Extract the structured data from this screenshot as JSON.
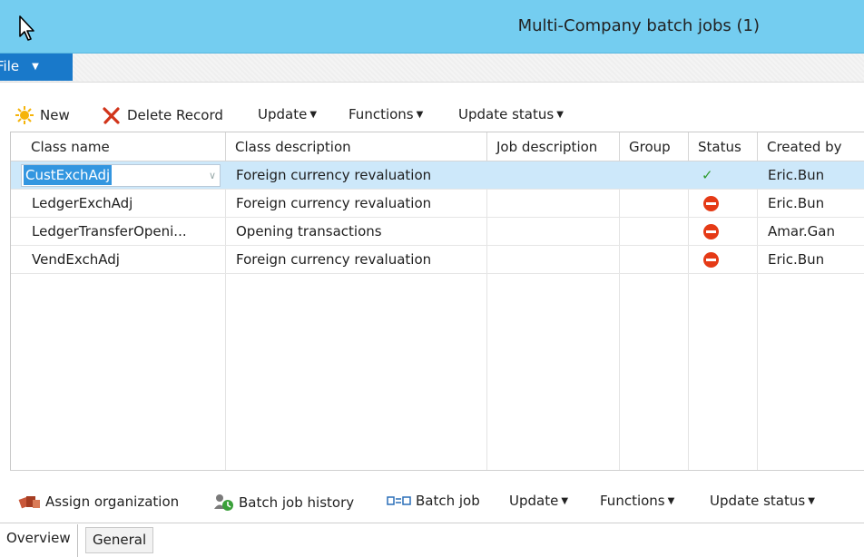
{
  "window": {
    "title": "Multi-Company batch jobs (1)"
  },
  "menu": {
    "file_label": "File"
  },
  "toolbar": {
    "new_label": "New",
    "delete_label": "Delete Record",
    "update_label": "Update",
    "functions_label": "Functions",
    "update_status_label": "Update status"
  },
  "grid": {
    "columns": [
      "Class name",
      "Class description",
      "Job description",
      "Group",
      "Status",
      "Created by"
    ],
    "rows": [
      {
        "class_name": "CustExchAdj",
        "class_description": "Foreign currency revaluation",
        "job_description": "",
        "group": "",
        "status": "success",
        "created_by": "Eric.Bun"
      },
      {
        "class_name": "LedgerExchAdj",
        "class_description": "Foreign currency revaluation",
        "job_description": "",
        "group": "",
        "status": "error",
        "created_by": "Eric.Bun"
      },
      {
        "class_name": "LedgerTransferOpeni...",
        "class_description": "Opening transactions",
        "job_description": "",
        "group": "",
        "status": "error",
        "created_by": "Amar.Gan"
      },
      {
        "class_name": "VendExchAdj",
        "class_description": "Foreign currency revaluation",
        "job_description": "",
        "group": "",
        "status": "error",
        "created_by": "Eric.Bun"
      }
    ]
  },
  "bottom_toolbar": {
    "assign_org_label": "Assign organization",
    "history_label": "Batch job history",
    "batch_job_label": "Batch job",
    "update_label": "Update",
    "functions_label": "Functions",
    "update_status_label": "Update status"
  },
  "tabs": {
    "overview_label": "Overview",
    "general_label": "General"
  },
  "colors": {
    "titlebar": "#74cdf0",
    "file_tab": "#1979ca",
    "selected_row": "#cde8fa",
    "success": "#2e9b2e",
    "error": "#e53a16"
  },
  "icons": {
    "cursor": "cursor-arrow-icon",
    "new": "new-sun-icon",
    "delete": "delete-x-icon",
    "assign": "organization-icon",
    "history": "history-icon",
    "batch": "batch-job-icon",
    "success": "checkmark-icon",
    "error": "stop-icon",
    "dropdown": "caret-down-icon"
  }
}
